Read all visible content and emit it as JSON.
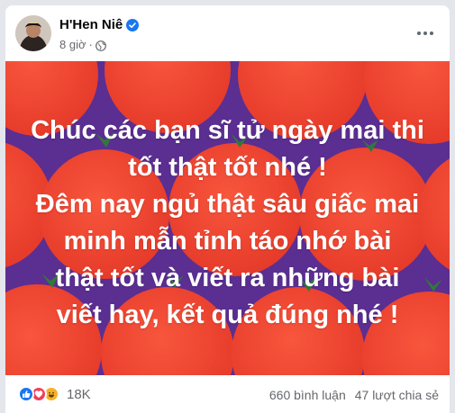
{
  "post": {
    "author": "H'Hen Niê",
    "time": "8 giờ",
    "separator": "·",
    "verified_icon": "verified-badge-icon",
    "audience_icon": "globe-icon",
    "more_icon": "more-options-icon"
  },
  "banner": {
    "lines": [
      "Chúc các bạn sĩ tử ngày mai thi",
      "tốt thật tốt nhé !",
      "Đêm nay ngủ thật sâu giấc mai",
      "minh mẫn tỉnh táo nhớ bài",
      "thật tốt và viết ra những bài",
      "viết hay, kết quả đúng nhé !"
    ],
    "colors": {
      "background": "#5b2e91",
      "fruit": "#f0452f",
      "text": "#ffffff"
    }
  },
  "footer": {
    "reactions": [
      "like",
      "love",
      "haha"
    ],
    "reaction_count": "18K",
    "comments": "660 bình luận",
    "shares": "47 lượt chia sẻ"
  },
  "colors": {
    "accent": "#1877f2",
    "secondary_text": "#65676b"
  }
}
